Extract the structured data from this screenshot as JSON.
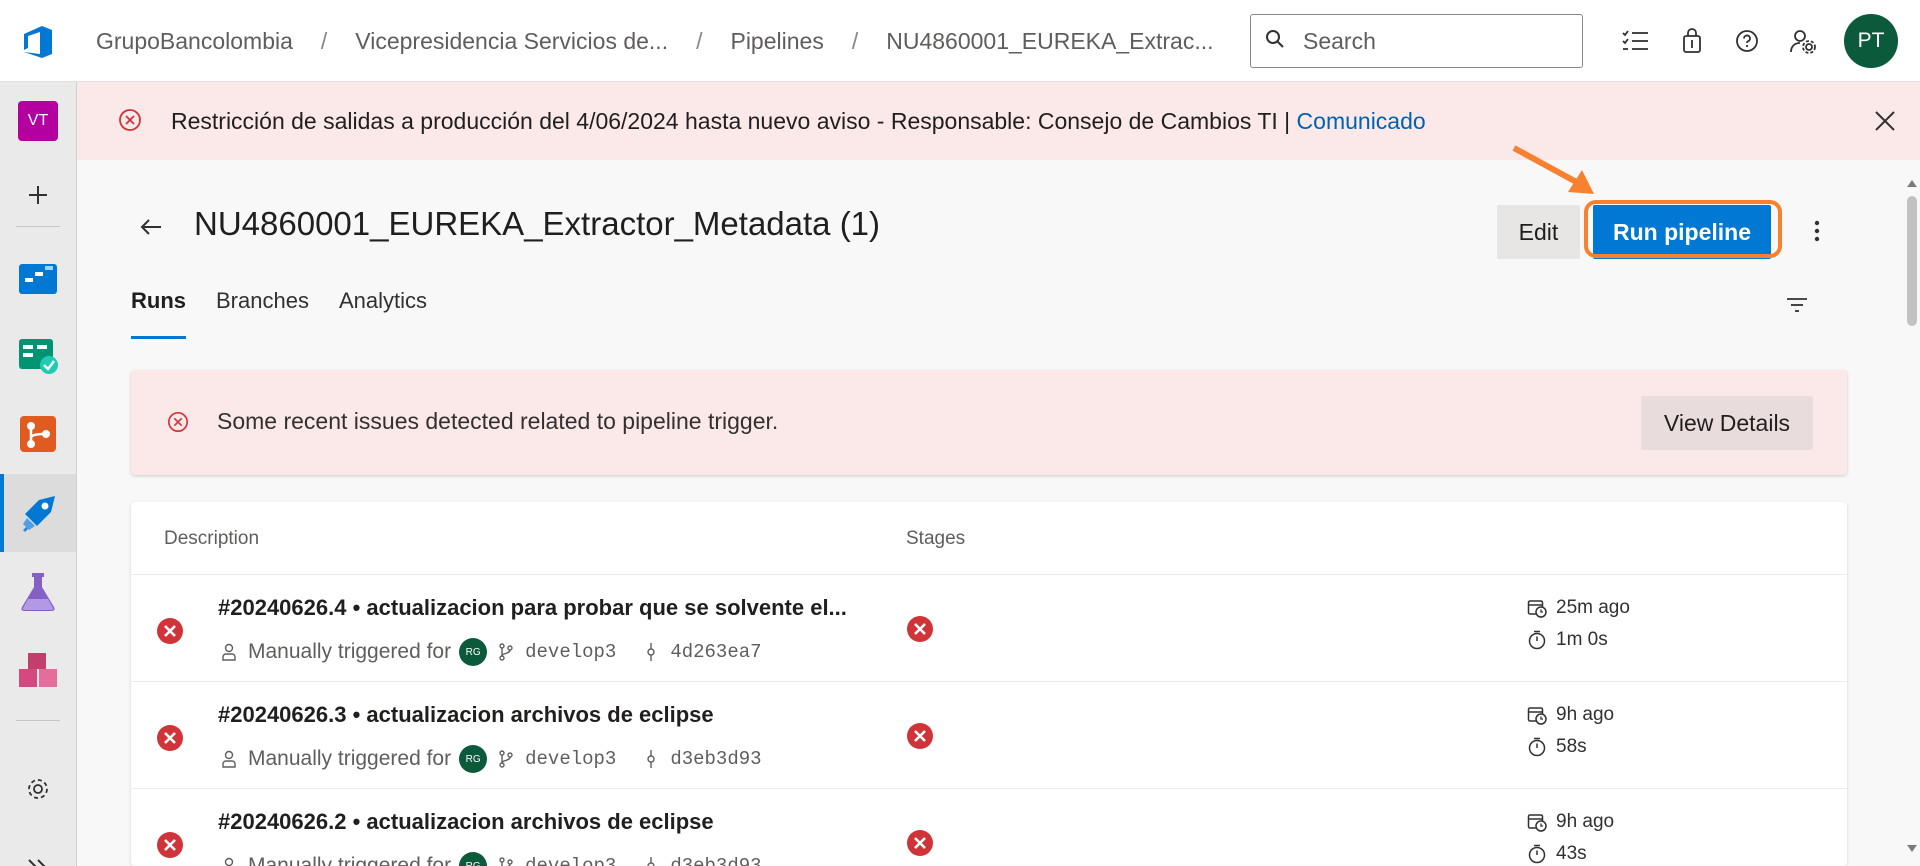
{
  "breadcrumb": {
    "items": [
      "GrupoBancolombia",
      "Vicepresidencia Servicios de...",
      "Pipelines",
      "NU4860001_EUREKA_Extrac..."
    ],
    "separator": "/"
  },
  "search": {
    "placeholder": "Search"
  },
  "user": {
    "initials": "PT"
  },
  "rail": {
    "project_initials": "VT"
  },
  "banner": {
    "text": "Restricción de salidas a producción del 4/06/2024 hasta nuevo aviso - Responsable: Consejo de Cambios TI | ",
    "link": "Comunicado"
  },
  "page": {
    "title": "NU4860001_EUREKA_Extractor_Metadata (1)",
    "edit_label": "Edit",
    "run_label": "Run pipeline"
  },
  "tabs": [
    {
      "label": "Runs"
    },
    {
      "label": "Branches"
    },
    {
      "label": "Analytics"
    }
  ],
  "issue": {
    "text": "Some recent issues detected related to pipeline trigger.",
    "button": "View Details"
  },
  "runs": {
    "headers": {
      "description": "Description",
      "stages": "Stages"
    },
    "rows": [
      {
        "title": "#20240626.4 • actualizacion para probar que se solvente el...",
        "trigger": "Manually triggered for",
        "avatar": "RG",
        "branch": "develop3",
        "commit": "4d263ea7",
        "when": "25m ago",
        "duration": "1m 0s"
      },
      {
        "title": "#20240626.3 • actualizacion archivos de eclipse",
        "trigger": "Manually triggered for",
        "avatar": "RG",
        "branch": "develop3",
        "commit": "d3eb3d93",
        "when": "9h ago",
        "duration": "58s"
      },
      {
        "title": "#20240626.2 • actualizacion archivos de eclipse",
        "trigger": "Manually triggered for",
        "avatar": "RG",
        "branch": "develop3",
        "commit": "d3eb3d93",
        "when": "9h ago",
        "duration": "43s"
      }
    ]
  },
  "colors": {
    "accent": "#0078d4",
    "error": "#d13438",
    "banner_bg": "#fbe9e9",
    "highlight": "#f7812f"
  }
}
